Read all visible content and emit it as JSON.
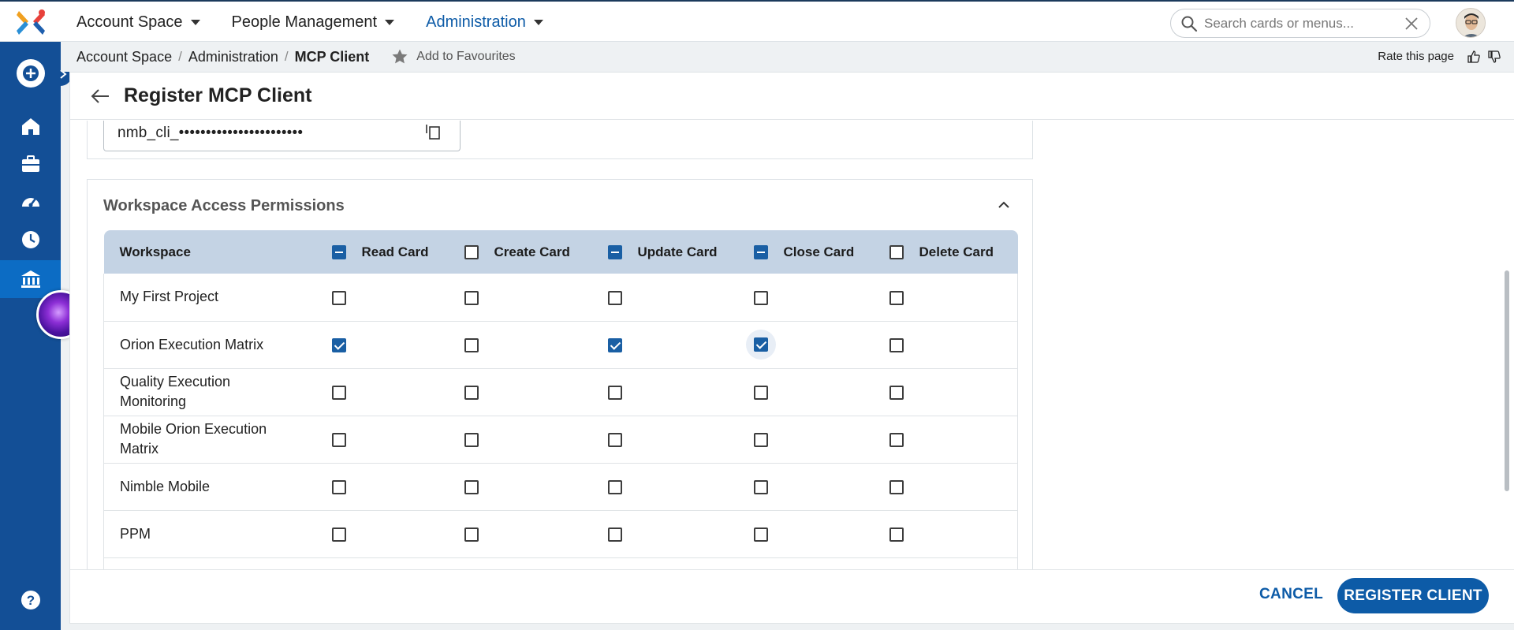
{
  "nav": {
    "items": [
      {
        "label": "Account Space"
      },
      {
        "label": "People Management"
      },
      {
        "label": "Administration"
      }
    ]
  },
  "search": {
    "placeholder": "Search cards or menus..."
  },
  "breadcrumb": {
    "items": [
      "Account Space",
      "Administration",
      "MCP Client"
    ],
    "separator": "/"
  },
  "favourites": {
    "label": "Add to Favourites"
  },
  "rate": {
    "label": "Rate this page"
  },
  "page": {
    "title": "Register MCP Client"
  },
  "secret": {
    "value": "nmb_cli_•••••••••••••••••••••••"
  },
  "permissions": {
    "title": "Workspace Access Permissions",
    "columns": [
      {
        "label": "Workspace"
      },
      {
        "label": "Read Card",
        "state": "indeterminate"
      },
      {
        "label": "Create Card",
        "state": "unchecked"
      },
      {
        "label": "Update Card",
        "state": "indeterminate"
      },
      {
        "label": "Close Card",
        "state": "indeterminate"
      },
      {
        "label": "Delete Card",
        "state": "unchecked"
      }
    ],
    "rows": [
      {
        "workspace": "My First Project",
        "read": false,
        "create": false,
        "update": false,
        "close": false,
        "delete": false
      },
      {
        "workspace": "Orion Execution Matrix",
        "read": true,
        "create": false,
        "update": true,
        "close": true,
        "delete": false
      },
      {
        "workspace": "Quality Execution Monitoring",
        "read": false,
        "create": false,
        "update": false,
        "close": false,
        "delete": false
      },
      {
        "workspace": "Mobile Orion Execution Matrix",
        "read": false,
        "create": false,
        "update": false,
        "close": false,
        "delete": false
      },
      {
        "workspace": "Nimble Mobile",
        "read": false,
        "create": false,
        "update": false,
        "close": false,
        "delete": false
      },
      {
        "workspace": "PPM",
        "read": false,
        "create": false,
        "update": false,
        "close": false,
        "delete": false
      }
    ]
  },
  "footer": {
    "cancel_label": "CANCEL",
    "register_label": "REGISTER CLIENT"
  },
  "colors": {
    "brand": "#0d5ba7",
    "sidebar": "#134f96",
    "table_header": "#c4d3e4"
  }
}
